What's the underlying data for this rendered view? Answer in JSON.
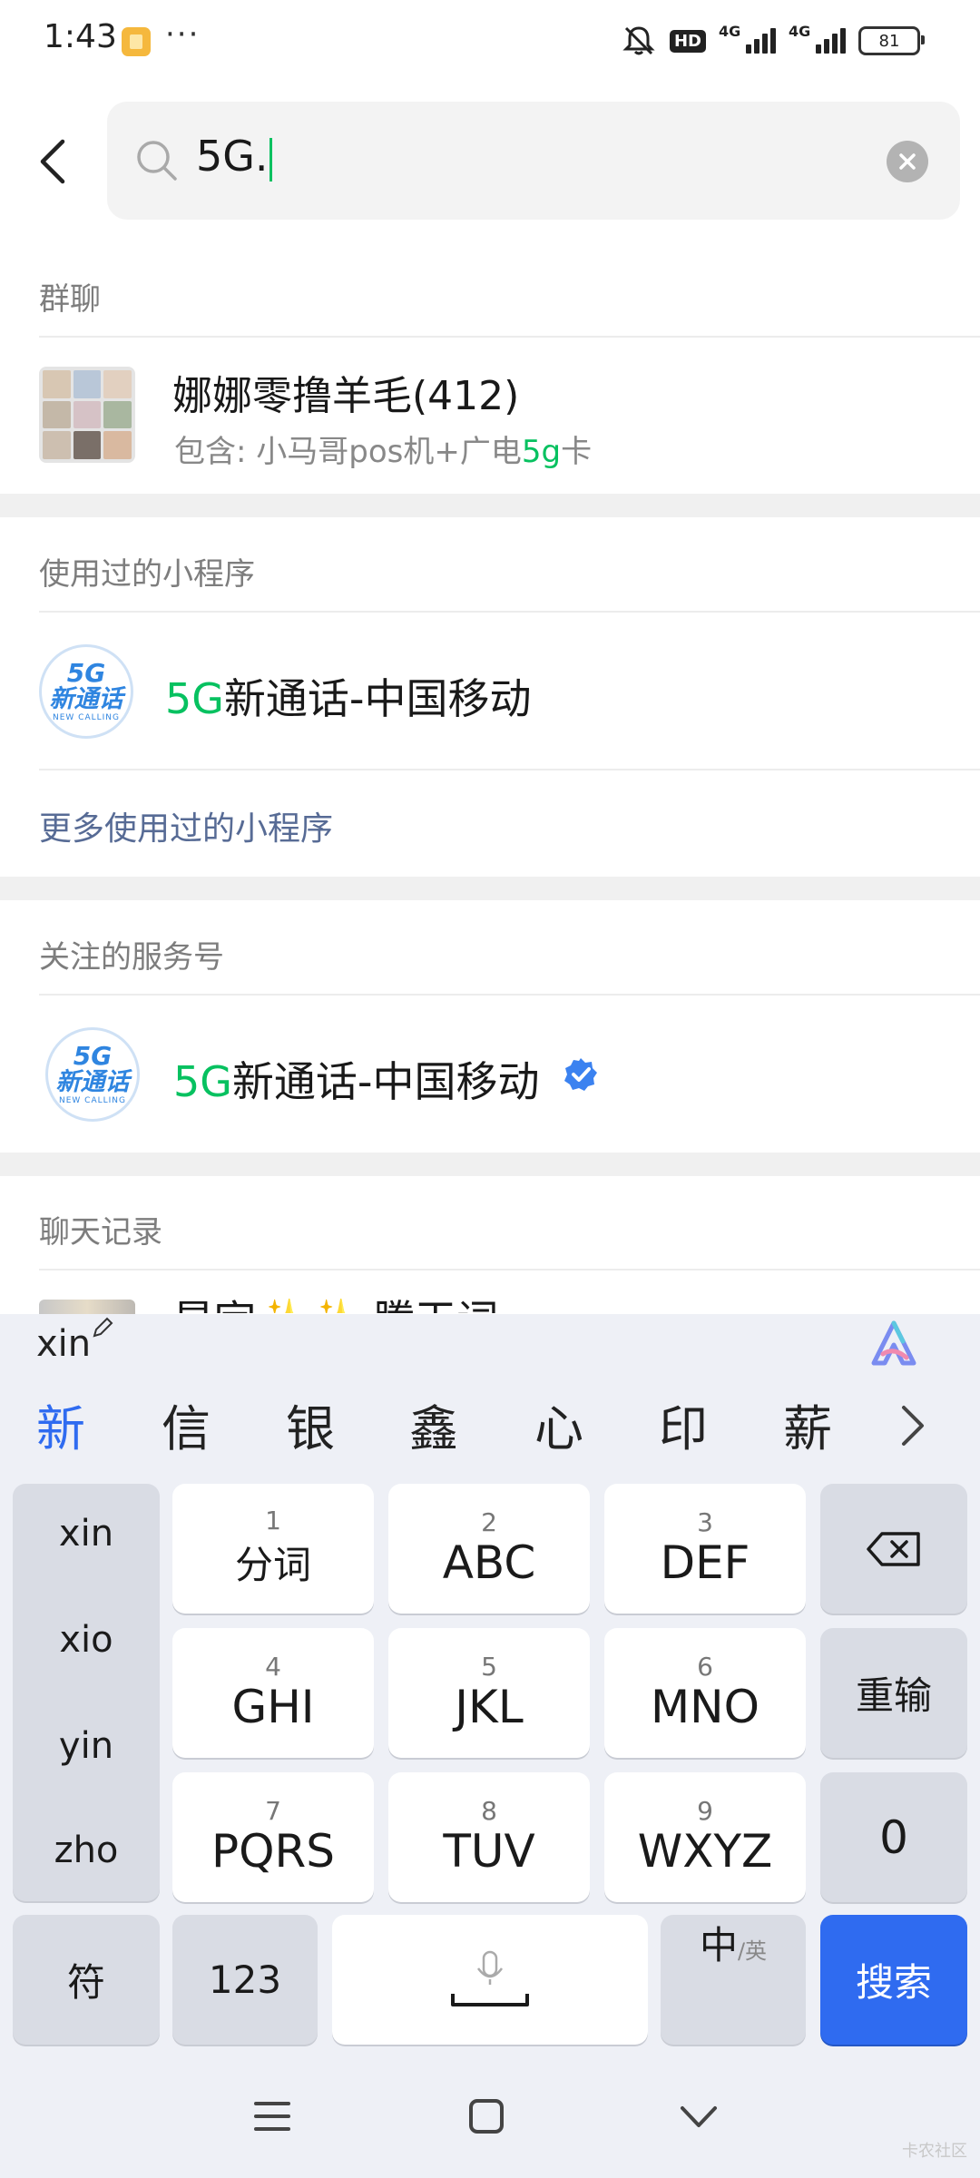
{
  "status_bar": {
    "time": "1:43",
    "more": "···",
    "hd": "HD",
    "net1": "4G",
    "net2": "4G",
    "battery": "81"
  },
  "search": {
    "query": "5G."
  },
  "sections": {
    "group_chats": {
      "title": "群聊",
      "item": {
        "name": "娜娜零撸羊毛(412)",
        "sub_prefix": "包含: 小马哥pos机+广电",
        "sub_highlight": "5g",
        "sub_suffix": "卡"
      }
    },
    "mini_programs": {
      "title": "使用过的小程序",
      "item": {
        "name_highlight": "5G",
        "name_rest": "新通话-中国移动"
      },
      "more_link": "更多使用过的小程序"
    },
    "service_accounts": {
      "title": "关注的服务号",
      "item": {
        "name_highlight": "5G",
        "name_rest": "新通话-中国移动"
      }
    },
    "chat_history": {
      "title": "聊天记录",
      "snippet": "星宇✨✨ 騰天词"
    }
  },
  "logo": {
    "line1": "5G",
    "line2": "新通话",
    "line3": "NEW CALLING"
  },
  "keyboard": {
    "pinyin": "xin",
    "candidates": [
      "新",
      "信",
      "银",
      "鑫",
      "心",
      "印",
      "薪"
    ],
    "pinyin_options": [
      "xin",
      "xio",
      "yin",
      "zho"
    ],
    "keys": [
      {
        "num": "1",
        "label": "分词"
      },
      {
        "num": "2",
        "label": "ABC"
      },
      {
        "num": "3",
        "label": "DEF"
      },
      {
        "num": "4",
        "label": "GHI"
      },
      {
        "num": "5",
        "label": "JKL"
      },
      {
        "num": "6",
        "label": "MNO"
      },
      {
        "num": "7",
        "label": "PQRS"
      },
      {
        "num": "8",
        "label": "TUV"
      },
      {
        "num": "9",
        "label": "WXYZ"
      }
    ],
    "reenter": "重输",
    "zero": "0",
    "symbol": "符",
    "numbers": "123",
    "lang_main": "中",
    "lang_sub": "/英",
    "search": "搜索"
  },
  "watermark": "卡农社区",
  "colors": {
    "highlight": "#07c160",
    "link": "#576b95",
    "search_key": "#2f6bf0",
    "keyboard_bg": "#eef0f6"
  }
}
